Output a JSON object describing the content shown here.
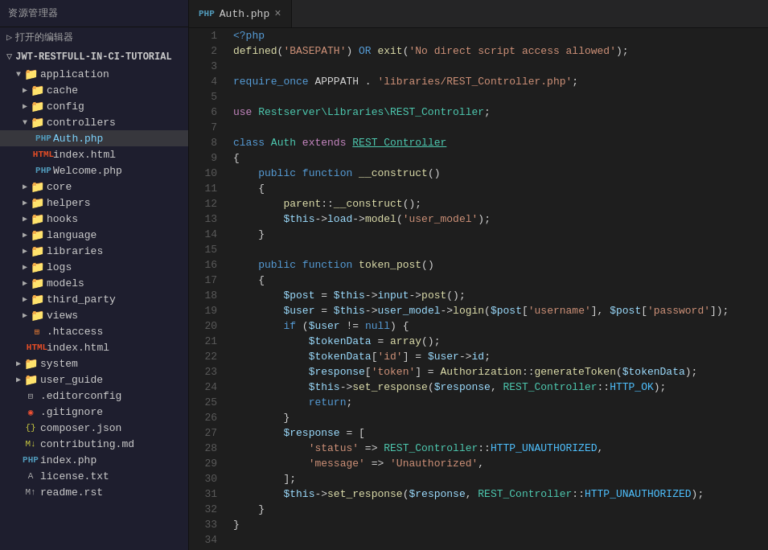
{
  "sidebar": {
    "header": "资源管理器",
    "openEditors": "打开的编辑器",
    "projectName": "JWT-RESTFULL-IN-CI-TUTORIAL",
    "items": [
      {
        "id": "application",
        "label": "application",
        "type": "folder-open",
        "level": 1,
        "expanded": true
      },
      {
        "id": "cache",
        "label": "cache",
        "type": "folder",
        "level": 2,
        "expanded": false
      },
      {
        "id": "config",
        "label": "config",
        "type": "folder",
        "level": 2,
        "expanded": false
      },
      {
        "id": "controllers",
        "label": "controllers",
        "type": "folder-open",
        "level": 2,
        "expanded": true
      },
      {
        "id": "auth-php",
        "label": "Auth.php",
        "type": "php",
        "level": 3,
        "active": true
      },
      {
        "id": "index-html-ctrl",
        "label": "index.html",
        "type": "html",
        "level": 3
      },
      {
        "id": "welcome-php",
        "label": "Welcome.php",
        "type": "php",
        "level": 3
      },
      {
        "id": "core",
        "label": "core",
        "type": "folder",
        "level": 2,
        "expanded": false
      },
      {
        "id": "helpers",
        "label": "helpers",
        "type": "folder",
        "level": 2,
        "expanded": false
      },
      {
        "id": "hooks",
        "label": "hooks",
        "type": "folder",
        "level": 2,
        "expanded": false
      },
      {
        "id": "language",
        "label": "language",
        "type": "folder",
        "level": 2,
        "expanded": false
      },
      {
        "id": "libraries",
        "label": "libraries",
        "type": "folder",
        "level": 2,
        "expanded": false
      },
      {
        "id": "logs",
        "label": "logs",
        "type": "folder",
        "level": 2,
        "expanded": false
      },
      {
        "id": "models",
        "label": "models",
        "type": "folder",
        "level": 2,
        "expanded": false
      },
      {
        "id": "third_party",
        "label": "third_party",
        "type": "folder",
        "level": 2,
        "expanded": false
      },
      {
        "id": "views",
        "label": "views",
        "type": "folder",
        "level": 2,
        "expanded": false
      },
      {
        "id": "htaccess",
        "label": ".htaccess",
        "type": "htaccess",
        "level": 2
      },
      {
        "id": "index-html-app",
        "label": "index.html",
        "type": "html",
        "level": 2
      },
      {
        "id": "system",
        "label": "system",
        "type": "folder",
        "level": 1,
        "expanded": false
      },
      {
        "id": "user_guide",
        "label": "user_guide",
        "type": "folder",
        "level": 1,
        "expanded": false
      },
      {
        "id": "editorconfig",
        "label": ".editorconfig",
        "type": "editorconfig",
        "level": 1
      },
      {
        "id": "gitignore",
        "label": ".gitignore",
        "type": "git",
        "level": 1
      },
      {
        "id": "composer-json",
        "label": "composer.json",
        "type": "json",
        "level": 1
      },
      {
        "id": "contributing-md",
        "label": "contributing.md",
        "type": "md",
        "level": 1
      },
      {
        "id": "index-php",
        "label": "index.php",
        "type": "php",
        "level": 1
      },
      {
        "id": "license-txt",
        "label": "license.txt",
        "type": "txt",
        "level": 1
      },
      {
        "id": "readme-rst",
        "label": "readme.rst",
        "type": "rst",
        "level": 1
      }
    ]
  },
  "tab": {
    "filename": "Auth.php",
    "close": "×"
  },
  "code": {
    "lines": 34
  }
}
